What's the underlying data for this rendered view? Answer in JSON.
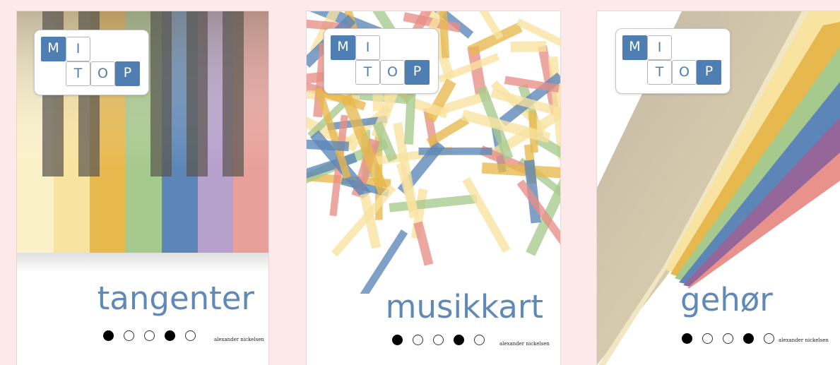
{
  "colors": {
    "background": "#fde9ea",
    "accent": "#4f7eb3",
    "title": "#6089b8",
    "red": "#e78e86",
    "yellow": "#f8e3a0",
    "gold": "#e7b84d",
    "green": "#a6c98d",
    "blue": "#5b86b7",
    "purple": "#b6a0cc"
  },
  "books": [
    {
      "logo": {
        "row1": [
          "M",
          "I"
        ],
        "row2": [
          "T",
          "O",
          "P"
        ]
      },
      "title": "tangenter",
      "dots": [
        true,
        false,
        false,
        true,
        false
      ],
      "author": "alexander nickelsen"
    },
    {
      "logo": {
        "row1": [
          "M",
          "I"
        ],
        "row2": [
          "T",
          "O",
          "P"
        ]
      },
      "title": "musikkart",
      "dots": [
        true,
        false,
        false,
        true,
        false
      ],
      "author": "alexander nickelsen"
    },
    {
      "logo": {
        "row1": [
          "M",
          "I"
        ],
        "row2": [
          "T",
          "O",
          "P"
        ]
      },
      "title": "gehør",
      "dots": [
        true,
        false,
        false,
        true,
        false
      ],
      "author": "alexander nickelsen"
    }
  ]
}
